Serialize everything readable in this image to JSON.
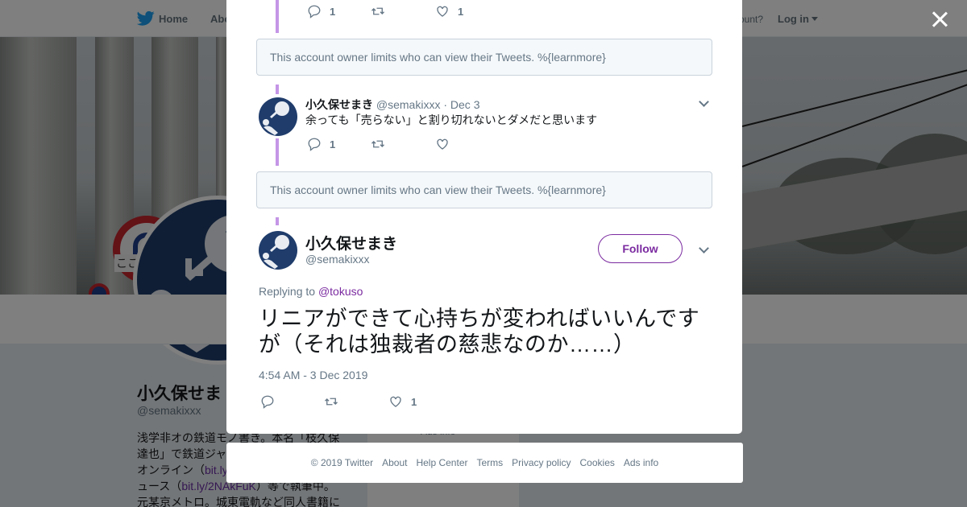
{
  "nav": {
    "home": "Home",
    "about": "Abo",
    "account_prompt": "ccount?",
    "login": "Log in"
  },
  "profile": {
    "name": "小久保せま",
    "handle": "@semakixxx",
    "bio_1": "浅学非オの鉄道モノ書き。本名「枝久保",
    "bio_2": "達也」で鉄道ジャ",
    "bio_3a": "オンライン（",
    "bio_3_link": "bit.ly",
    "bio_4a": "ュース（",
    "bio_4_link": "bit.ly/2NAkFuK",
    "bio_4b": "）等で執筆中。",
    "bio_5": "元某京メトロ。城東電軌など同人書籍に",
    "side_card_text": "Ads info",
    "banner_sign_text": "ここ"
  },
  "thread": {
    "top_actions": {
      "reply_count": "1",
      "retweet_count": "",
      "like_count": "1"
    },
    "tombstone_1": "This account owner limits who can view their Tweets. %{learnmore}",
    "reply_tweet": {
      "name": "小久保せまき",
      "handle": "@semakixxx",
      "separator": "·",
      "date": "Dec 3",
      "text": "余っても「売らない」と割り切れないとダメだと思います",
      "reply_count": "1",
      "retweet_count": "",
      "like_count": ""
    },
    "tombstone_2": "This account owner limits who can view their Tweets. %{learnmore}",
    "main_tweet": {
      "name": "小久保せまき",
      "handle": "@semakixxx",
      "follow_label": "Follow",
      "replying_prefix": "Replying to",
      "replying_to": "@tokuso",
      "text": "リニアができて心持ちが変わればいいんですが（それは独裁者の慈悲なのか……）",
      "timestamp": "4:54 AM - 3 Dec 2019",
      "reply_count": "",
      "retweet_count": "",
      "like_count": "1"
    }
  },
  "footer": {
    "copyright": "© 2019 Twitter",
    "about": "About",
    "help": "Help Center",
    "terms": "Terms",
    "privacy": "Privacy policy",
    "cookies": "Cookies",
    "ads": "Ads info"
  },
  "colors": {
    "accent_purple": "#7b2ba0",
    "thread_line": "#c495e6",
    "avatar_navy": "#1f3c6b",
    "overlay": "rgba(0,0,0,0.5)"
  },
  "icons": [
    "twitter-bird-icon",
    "caret-down-icon",
    "close-icon",
    "reply-icon",
    "retweet-icon",
    "heart-icon",
    "chevron-down-icon"
  ]
}
